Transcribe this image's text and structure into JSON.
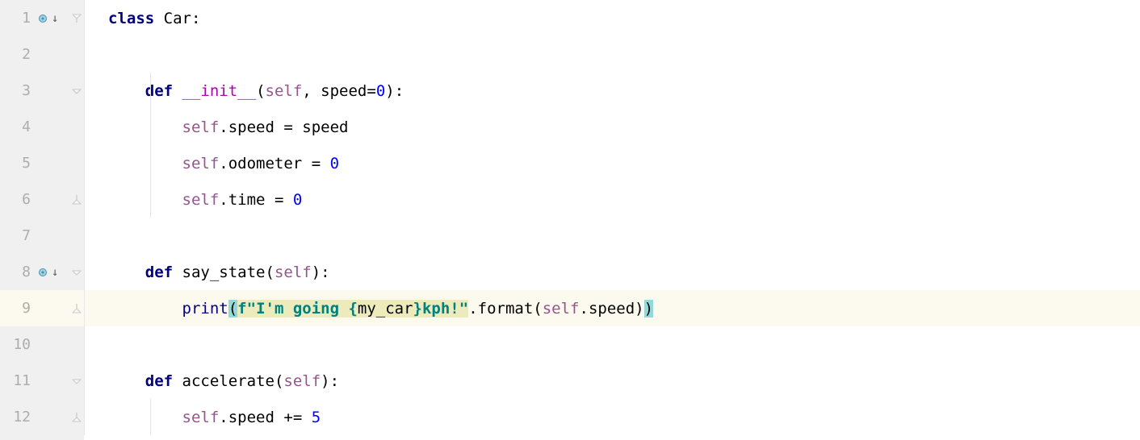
{
  "lines": {
    "n1": "1",
    "n2": "2",
    "n3": "3",
    "n4": "4",
    "n5": "5",
    "n6": "6",
    "n7": "7",
    "n8": "8",
    "n9": "9",
    "n10": "10",
    "n11": "11",
    "n12": "12"
  },
  "code": {
    "l1": {
      "kw_class": "class",
      "sp": " ",
      "name": "Car",
      "colon": ":"
    },
    "l3": {
      "indent": "    ",
      "kw_def": "def",
      "sp": " ",
      "name": "__init__",
      "open": "(",
      "self": "self",
      "comma": ", ",
      "param": "speed",
      "eq": "=",
      "default": "0",
      "close": ")",
      "colon": ":"
    },
    "l4": {
      "indent": "        ",
      "self": "self",
      "dot": ".",
      "attr": "speed",
      "sp": " ",
      "eq": "=",
      "sp2": " ",
      "val": "speed"
    },
    "l5": {
      "indent": "        ",
      "self": "self",
      "dot": ".",
      "attr": "odometer",
      "sp": " ",
      "eq": "=",
      "sp2": " ",
      "val": "0"
    },
    "l6": {
      "indent": "        ",
      "self": "self",
      "dot": ".",
      "attr": "time",
      "sp": " ",
      "eq": "=",
      "sp2": " ",
      "val": "0"
    },
    "l8": {
      "indent": "    ",
      "kw_def": "def",
      "sp": " ",
      "name": "say_state",
      "open": "(",
      "self": "self",
      "close": ")",
      "colon": ":"
    },
    "l9": {
      "indent": "        ",
      "fn": "print",
      "open": "(",
      "fprefix": "f",
      "str1": "\"I'm going {",
      "var": "my_car",
      "str2": "}kph!\"",
      "dot": ".",
      "method": "format",
      "open2": "(",
      "self": "self",
      "dot2": ".",
      "attr": "speed",
      "close2": ")",
      "close": ")"
    },
    "l11": {
      "indent": "    ",
      "kw_def": "def",
      "sp": " ",
      "name": "accelerate",
      "open": "(",
      "self": "self",
      "close": ")",
      "colon": ":"
    },
    "l12": {
      "indent": "        ",
      "self": "self",
      "dot": ".",
      "attr": "speed",
      "sp": " ",
      "op": "+=",
      "sp2": " ",
      "val": "5"
    }
  },
  "icons": {
    "override": "override-icon",
    "fold_open": "fold-open",
    "fold_close": "fold-close"
  }
}
